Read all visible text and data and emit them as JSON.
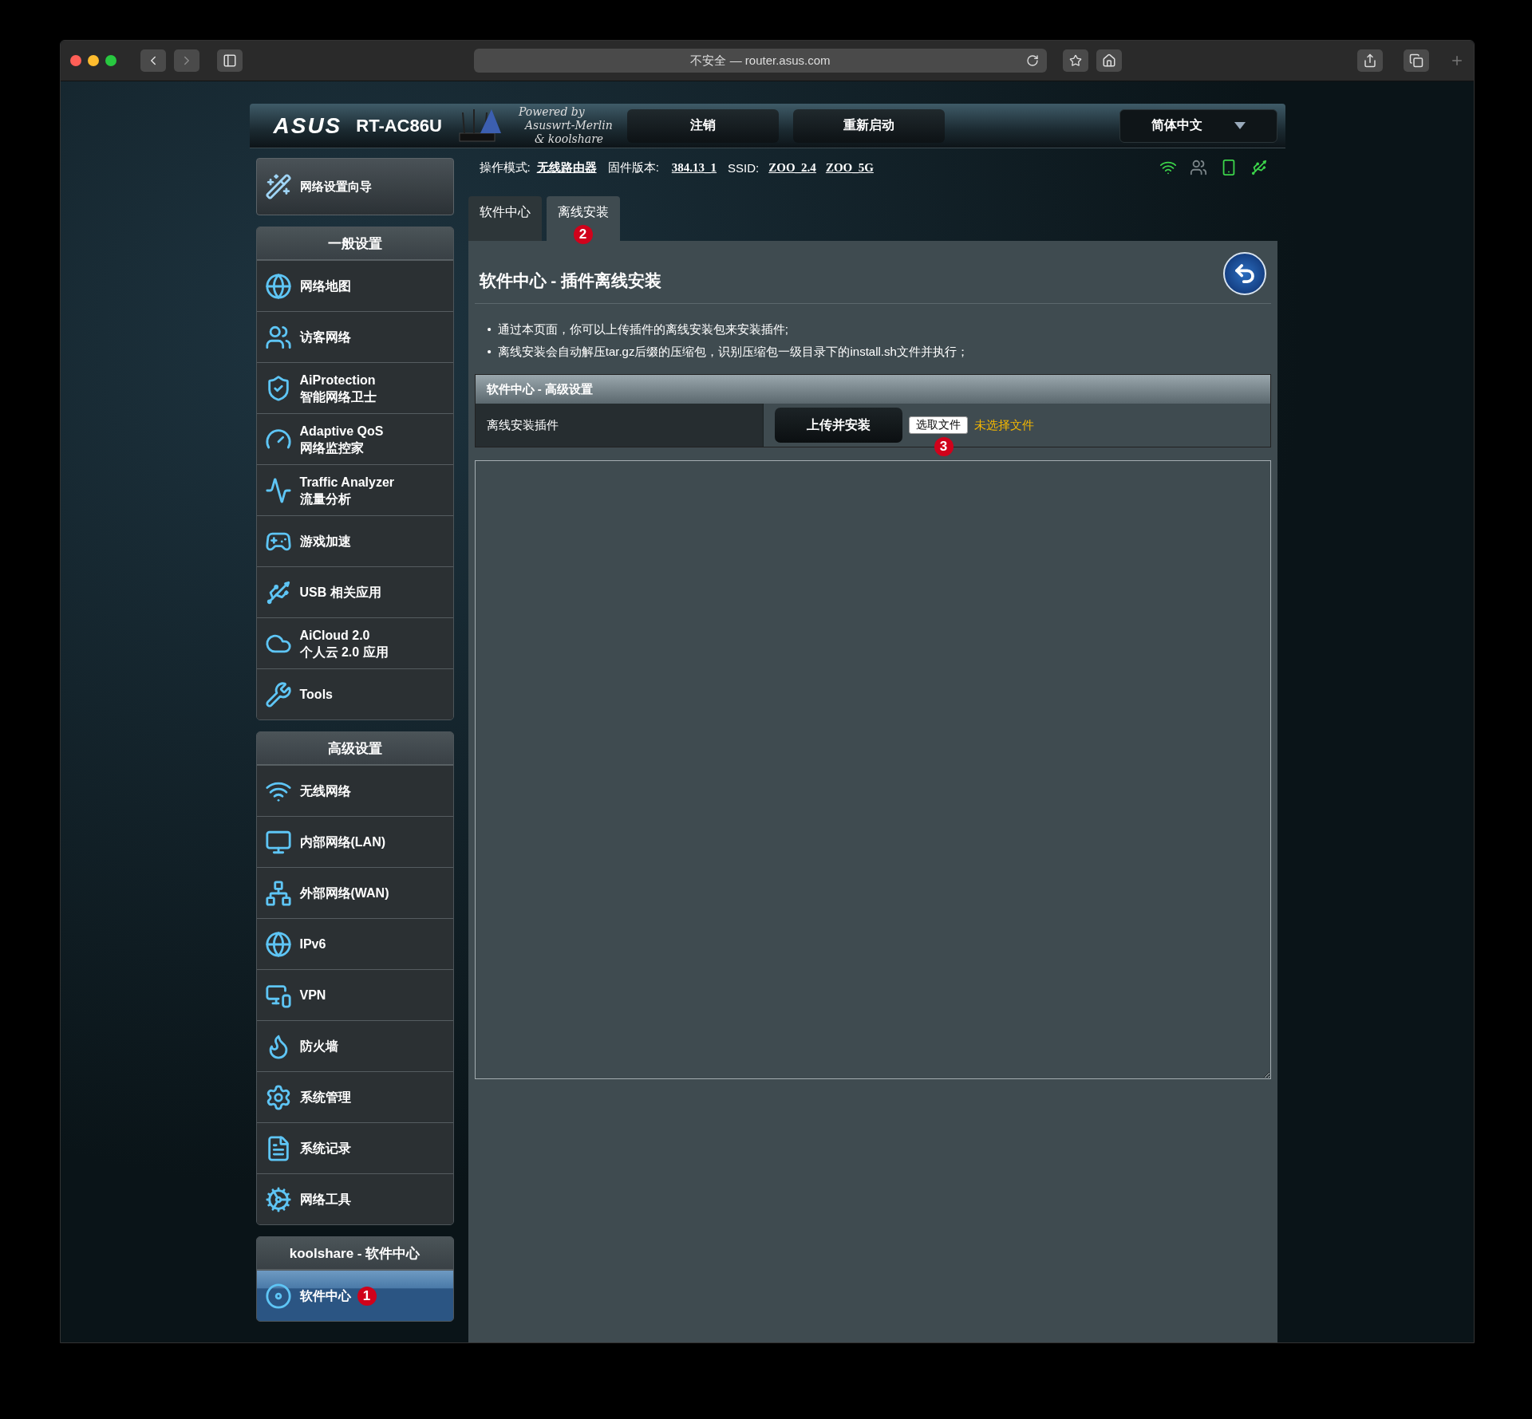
{
  "browser": {
    "address": "不安全 — router.asus.com"
  },
  "header": {
    "logo": "ASUS",
    "model": "RT-AC86U",
    "powered": [
      "Powered by",
      "Asuswrt-Merlin",
      "& koolshare"
    ],
    "buttons": [
      "注销",
      "重新启动"
    ],
    "language": "简体中文"
  },
  "status": {
    "mode_label": "操作模式:",
    "mode": "无线路由器",
    "firmware_label": "固件版本:",
    "firmware": "384.13_1",
    "ssid_label": "SSID:",
    "ssids": [
      "ZOO_2.4",
      "ZOO_5G"
    ]
  },
  "sidebar": {
    "wizard": "网络设置向导",
    "sections": [
      {
        "title": "一般设置",
        "items": [
          {
            "label": "网络地图",
            "selected": false
          },
          {
            "label": "访客网络",
            "selected": false
          },
          {
            "label": "AiProtection",
            "sublabel": "智能网络卫士",
            "selected": false
          },
          {
            "label": "Adaptive QoS",
            "sublabel": "网络监控家",
            "selected": false
          },
          {
            "label": "Traffic Analyzer",
            "sublabel": "流量分析",
            "selected": false
          },
          {
            "label": "游戏加速",
            "selected": false
          },
          {
            "label": "USB 相关应用",
            "selected": false
          },
          {
            "label": "AiCloud 2.0",
            "sublabel": "个人云 2.0 应用",
            "selected": false
          },
          {
            "label": "Tools",
            "selected": false
          }
        ]
      },
      {
        "title": "高级设置",
        "items": [
          {
            "label": "无线网络",
            "selected": false
          },
          {
            "label": "内部网络(LAN)",
            "selected": false
          },
          {
            "label": "外部网络(WAN)",
            "selected": false
          },
          {
            "label": "IPv6",
            "selected": false
          },
          {
            "label": "VPN",
            "selected": false
          },
          {
            "label": "防火墙",
            "selected": false
          },
          {
            "label": "系统管理",
            "selected": false
          },
          {
            "label": "系统记录",
            "selected": false
          },
          {
            "label": "网络工具",
            "selected": false
          }
        ]
      },
      {
        "title": "koolshare - 软件中心",
        "items": [
          {
            "label": "软件中心",
            "selected": true,
            "badge": "1"
          }
        ]
      }
    ]
  },
  "tabs": [
    {
      "label": "软件中心",
      "selected": false
    },
    {
      "label": "离线安装",
      "selected": true,
      "badge": "2"
    }
  ],
  "content": {
    "title": "软件中心 - 插件离线安装",
    "notes": [
      {
        "marker": "•",
        "text": "通过本页面，你可以上传插件的离线安装包来安装插件;"
      },
      {
        "marker": "•",
        "text": "离线安装会自动解压tar.gz后缀的压缩包，识别压缩包一级目录下的install.sh文件并执行；"
      }
    ],
    "table": {
      "header": "软件中心 - 高级设置",
      "row_label": "离线安装插件",
      "upload_button": "上传并安装",
      "file_button": "选取文件",
      "file_status": "未选择文件",
      "badge": "3"
    }
  }
}
